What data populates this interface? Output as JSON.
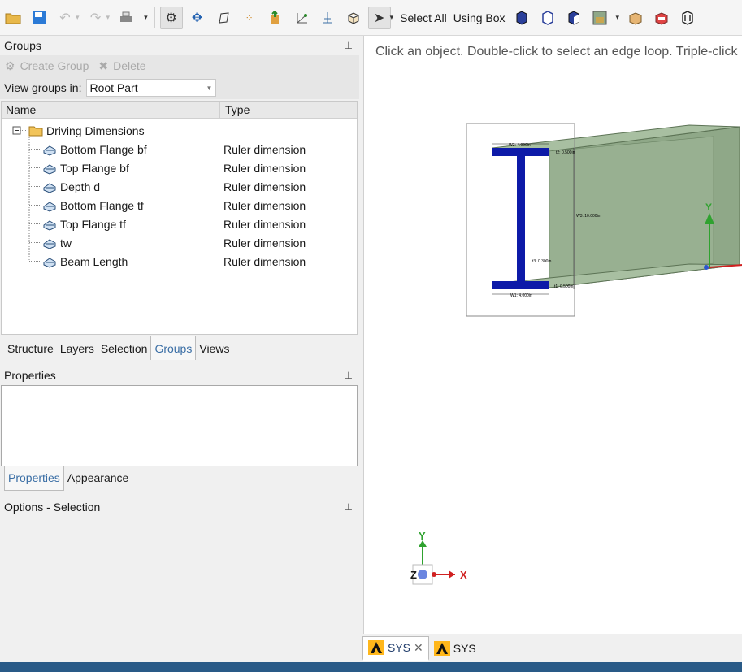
{
  "toolbar": {
    "select_all_label": "Select All",
    "using_box_label": "Using Box"
  },
  "groups_panel": {
    "title": "Groups",
    "create_group_label": "Create Group",
    "delete_label": "Delete",
    "view_groups_label": "View groups in:",
    "view_groups_value": "Root Part",
    "columns": [
      "Name",
      "Type"
    ],
    "folder": "Driving Dimensions",
    "items": [
      {
        "name": "Bottom Flange  bf",
        "type": "Ruler dimension"
      },
      {
        "name": "Top Flange  bf",
        "type": "Ruler dimension"
      },
      {
        "name": "Depth  d",
        "type": "Ruler dimension"
      },
      {
        "name": "Bottom Flange  tf",
        "type": "Ruler dimension"
      },
      {
        "name": "Top Flange  tf",
        "type": "Ruler dimension"
      },
      {
        "name": "tw",
        "type": "Ruler dimension"
      },
      {
        "name": "Beam Length",
        "type": "Ruler dimension"
      }
    ],
    "tabs": [
      "Structure",
      "Layers",
      "Selection",
      "Groups",
      "Views"
    ],
    "active_tab": "Groups"
  },
  "properties_panel": {
    "title": "Properties",
    "tabs": [
      "Properties",
      "Appearance"
    ],
    "active_tab": "Properties"
  },
  "options_panel": {
    "title": "Options - Selection"
  },
  "viewport": {
    "hint": "Click an object. Double-click to select an edge loop. Triple-click",
    "triad": {
      "y": "Y",
      "x": "X",
      "z": "Z"
    },
    "dim_labels": {
      "w2": "W2: 4.000in",
      "t2": "t2: 0.500in",
      "w3": "W3: 10.000in",
      "t3": "t3: 0.300in",
      "t1": "t1: 0.500in",
      "w1": "W1: 4.000in"
    }
  },
  "doc_tabs": [
    {
      "label": "SYS",
      "closable": true
    },
    {
      "label": "SYS",
      "closable": false
    }
  ],
  "colors": {
    "beam_green": "#8fa888",
    "section_blue": "#0d1aa8",
    "status_bar": "#295a87",
    "active_tab_text": "#3a6ea5"
  }
}
